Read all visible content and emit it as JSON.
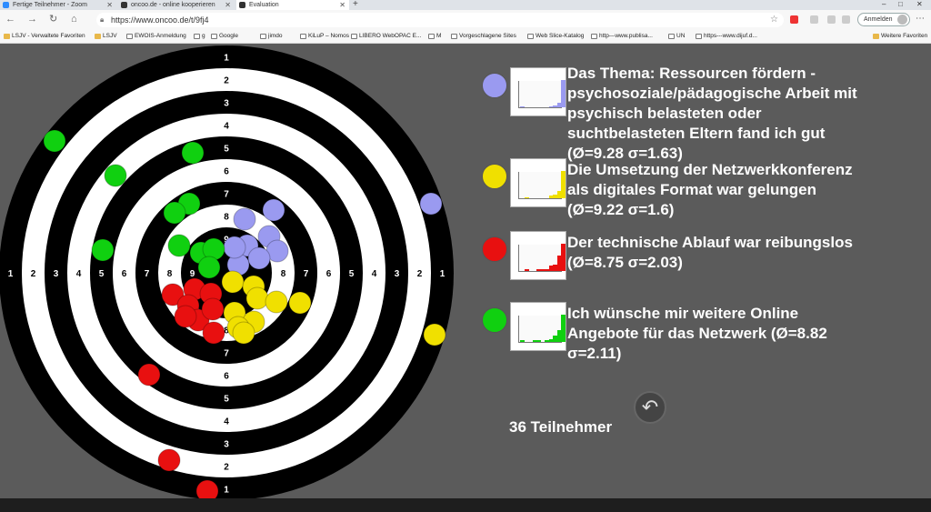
{
  "browser": {
    "tabs": [
      {
        "label": "Fertige Teilnehmer - Zoom",
        "color": "#2d8cff"
      },
      {
        "label": "oncoo.de - online kooperieren",
        "color": "#333333"
      },
      {
        "label": "Evaluation",
        "color": "#333333"
      }
    ],
    "url": "https://www.oncoo.de/t/9fj4",
    "signin_label": "Anmelden",
    "bookmarks": [
      {
        "label": "LSJV - Verwaltete Favoriten",
        "kind": "folder"
      },
      {
        "label": "LSJV",
        "kind": "folder"
      },
      {
        "label": "EWOIS-Anmeldung",
        "kind": "page"
      },
      {
        "label": "g",
        "kind": "page"
      },
      {
        "label": "Google",
        "kind": "page"
      },
      {
        "label": "jimdo",
        "kind": "page"
      },
      {
        "label": "KiLuP – Nomos",
        "kind": "page"
      },
      {
        "label": "LIBERO WebOPAC E...",
        "kind": "page"
      },
      {
        "label": "M",
        "kind": "page"
      },
      {
        "label": "Vorgeschlagene Sites",
        "kind": "page"
      },
      {
        "label": "Web Slice-Katalog",
        "kind": "page"
      },
      {
        "label": "http---www.publisa...",
        "kind": "page"
      },
      {
        "label": "UN",
        "kind": "page"
      },
      {
        "label": "https---www.dijuf.d...",
        "kind": "page"
      }
    ],
    "other_favorites": "Weitere Favoriten"
  },
  "target_rings": {
    "horizontal_left": [
      "1",
      "2",
      "3",
      "4",
      "5",
      "6",
      "7",
      "8",
      "9"
    ],
    "horizontal_right": [
      "8",
      "7",
      "6",
      "5",
      "4",
      "3",
      "2",
      "1"
    ],
    "vertical_top": [
      "1",
      "2",
      "3",
      "4",
      "5",
      "6",
      "7",
      "8",
      "9"
    ],
    "vertical_bottom": [
      "8",
      "7",
      "6",
      "5",
      "4",
      "3",
      "2",
      "1"
    ]
  },
  "questions": [
    {
      "color": "#9a9af0",
      "text": "Das Thema: Ressourcen fördern - psychosoziale/pädagogische Arbeit mit psychisch belasteten oder suchtbelasteten Eltern fand ich gut (Ø=9.28 σ=1.63)",
      "lines": [
        "Das Thema: Ressourcen fördern -",
        "psychosoziale/pädagogische Arbeit mit",
        "psychisch belasteten oder",
        "suchtbelasteten Eltern fand ich gut",
        "(Ø=9.28 σ=1.63)"
      ],
      "bars": [
        1,
        0,
        0,
        0,
        0,
        0,
        0,
        1,
        2,
        4,
        26
      ]
    },
    {
      "color": "#f0e000",
      "lines": [
        "Die Umsetzung der Netzwerkkonferenz",
        "als digitales Format war gelungen",
        "(Ø=9.22 σ=1.6)"
      ],
      "bars": [
        0,
        1,
        0,
        0,
        0,
        0,
        0,
        2,
        3,
        6,
        23
      ]
    },
    {
      "color": "#e81010",
      "lines": [
        "Der technische Ablauf war reibungslos",
        "(Ø=8.75 σ=2.03)"
      ],
      "bars": [
        0,
        1,
        0,
        0,
        1,
        1,
        1,
        3,
        4,
        9,
        16
      ]
    },
    {
      "color": "#10d010",
      "lines": [
        "Ich wünsche mir weitere Online",
        "Angebote für das Netzwerk (Ø=8.82",
        "σ=2.11)"
      ],
      "bars": [
        1,
        0,
        0,
        1,
        1,
        0,
        1,
        2,
        4,
        8,
        18
      ]
    }
  ],
  "participants_label": "36 Teilnehmer",
  "back_icon": "undo-arrow-icon"
}
